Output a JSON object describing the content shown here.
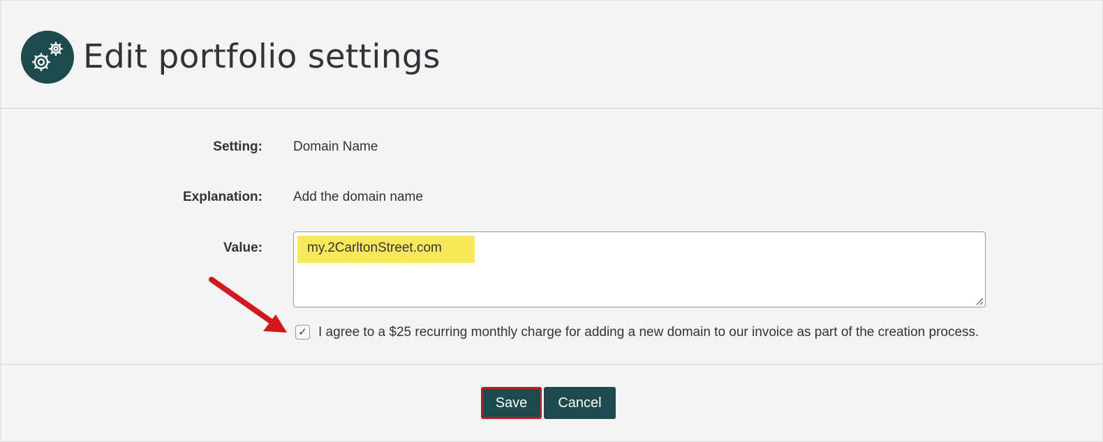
{
  "header": {
    "title": "Edit portfolio settings",
    "icon": "gears-icon"
  },
  "form": {
    "setting_label": "Setting:",
    "setting_value": "Domain Name",
    "explanation_label": "Explanation:",
    "explanation_value": "Add the domain name",
    "value_label": "Value:",
    "value_text": "my.2CarltonStreet.com",
    "agree_checked": true,
    "agree_label": "I agree to a $25 recurring monthly charge for adding a new domain to our invoice as part of the creation process."
  },
  "actions": {
    "save_label": "Save",
    "cancel_label": "Cancel"
  },
  "colors": {
    "brand": "#1c4a4d",
    "highlight": "#fbe85a",
    "annotation": "#d4161d"
  }
}
